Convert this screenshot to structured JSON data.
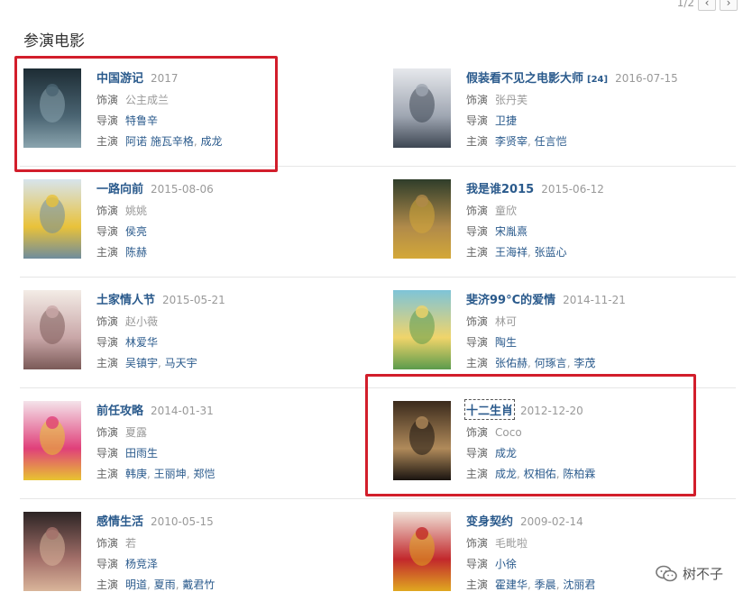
{
  "pager": {
    "page": "1/2",
    "prev_icon": "‹",
    "next_icon": "›"
  },
  "section_title": "参演电影",
  "labels": {
    "role": "饰演",
    "director": "导演",
    "cast": "主演"
  },
  "watermark": "树不子",
  "movies": [
    {
      "title": "中国游记",
      "sup": "",
      "date": "2017",
      "role": "公主成兰",
      "director": [
        "特鲁辛"
      ],
      "cast": [
        "阿诺 施瓦辛格",
        "成龙"
      ],
      "poster": [
        "#1d2c34",
        "#4a6472",
        "#8aa4ae"
      ]
    },
    {
      "title": "假装看不见之电影大师",
      "sup": "[24]",
      "date": "2016-07-15",
      "role": "张丹芙",
      "director": [
        "卫捷"
      ],
      "cast": [
        "李贤宰",
        "任言恺"
      ],
      "poster": [
        "#e6e8ec",
        "#9fa6b2",
        "#3d4652"
      ]
    },
    {
      "title": "一路向前",
      "sup": "",
      "date": "2015-08-06",
      "role": "姚姚",
      "director": [
        "侯亮"
      ],
      "cast": [
        "陈赫"
      ],
      "poster": [
        "#d7e4ec",
        "#e9c23a",
        "#6f8c9c"
      ]
    },
    {
      "title": "我是谁2015",
      "sup": "",
      "date": "2015-06-12",
      "role": "童欣",
      "director": [
        "宋胤熹"
      ],
      "cast": [
        "王海祥",
        "张蓝心"
      ],
      "poster": [
        "#2f3d2a",
        "#b08a4a",
        "#d4a838"
      ]
    },
    {
      "title": "土家情人节",
      "sup": "",
      "date": "2015-05-21",
      "role": "赵小薇",
      "director": [
        "林爱华"
      ],
      "cast": [
        "吴镇宇",
        "马天宇"
      ],
      "poster": [
        "#f3ece6",
        "#c9a7a8",
        "#7b5a58"
      ]
    },
    {
      "title": "斐济99°C的爱情",
      "sup": "",
      "date": "2014-11-21",
      "role": "林可",
      "director": [
        "陶生"
      ],
      "cast": [
        "张佑赫",
        "何琢言",
        "李茂"
      ],
      "poster": [
        "#7ec4d8",
        "#f0d46a",
        "#5c9b4c"
      ]
    },
    {
      "title": "前任攻略",
      "sup": "",
      "date": "2014-01-31",
      "role": "夏露",
      "director": [
        "田雨生"
      ],
      "cast": [
        "韩庚",
        "王丽坤",
        "郑恺"
      ],
      "poster": [
        "#f4e3ea",
        "#e0407a",
        "#e8c430"
      ]
    },
    {
      "title": "十二生肖",
      "sup": "",
      "date": "2012-12-20",
      "role": "Coco",
      "director": [
        "成龙"
      ],
      "cast": [
        "成龙",
        "权相佑",
        "陈柏霖"
      ],
      "poster": [
        "#3a2a1c",
        "#b08a5a",
        "#1a1410"
      ]
    },
    {
      "title": "感情生活",
      "sup": "",
      "date": "2010-05-15",
      "role": "若",
      "director": [
        "杨竞泽"
      ],
      "cast": [
        "明道",
        "夏雨",
        "戴君竹"
      ],
      "poster": [
        "#2c2424",
        "#a4706a",
        "#d9b59a"
      ]
    },
    {
      "title": "变身契约",
      "sup": "",
      "date": "2009-02-14",
      "role": "毛毗啦",
      "director": [
        "小徐"
      ],
      "cast": [
        "霍建华",
        "季晨",
        "沈丽君"
      ],
      "poster": [
        "#f0e2d8",
        "#c2282c",
        "#e0a820"
      ]
    }
  ]
}
